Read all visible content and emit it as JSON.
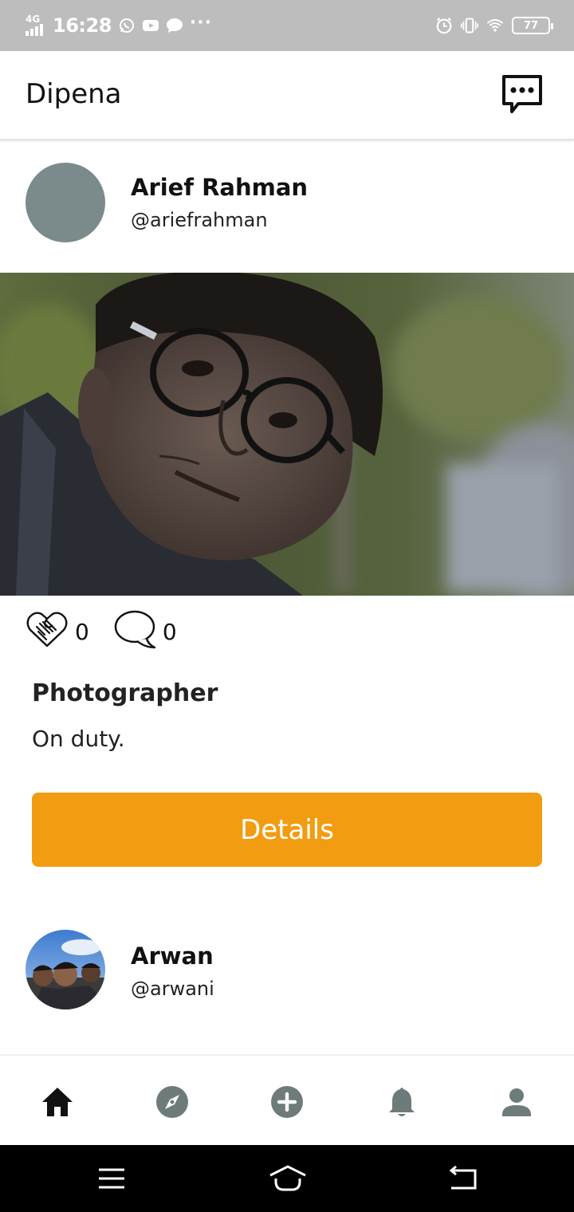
{
  "status_bar": {
    "network": "4G",
    "time": "16:28",
    "battery": "77",
    "icons": [
      "whatsapp-icon",
      "youtube-icon",
      "chat-bubble-icon",
      "more-icon",
      "alarm-icon",
      "vibrate-icon",
      "wifi-icon",
      "battery-icon"
    ]
  },
  "app_bar": {
    "title": "Dipena",
    "messages_icon": "message-dots-icon"
  },
  "posts": [
    {
      "author_name": "Arief Rahman",
      "author_handle": "@ariefrahman",
      "likes": "0",
      "comments": "0",
      "title": "Photographer",
      "description": "On duty.",
      "button_label": "Details"
    },
    {
      "author_name": "Arwan",
      "author_handle": "@arwani"
    }
  ],
  "bottom_nav": {
    "items": [
      "home-icon",
      "explore-icon",
      "add-icon",
      "notifications-icon",
      "profile-icon"
    ],
    "active": "home-icon",
    "active_color": "#111111",
    "inactive_color": "#6e7b7b"
  },
  "colors": {
    "accent": "#f29c11",
    "avatar_placeholder": "#7b8b8b",
    "status_bar": "#bdbdbd"
  }
}
